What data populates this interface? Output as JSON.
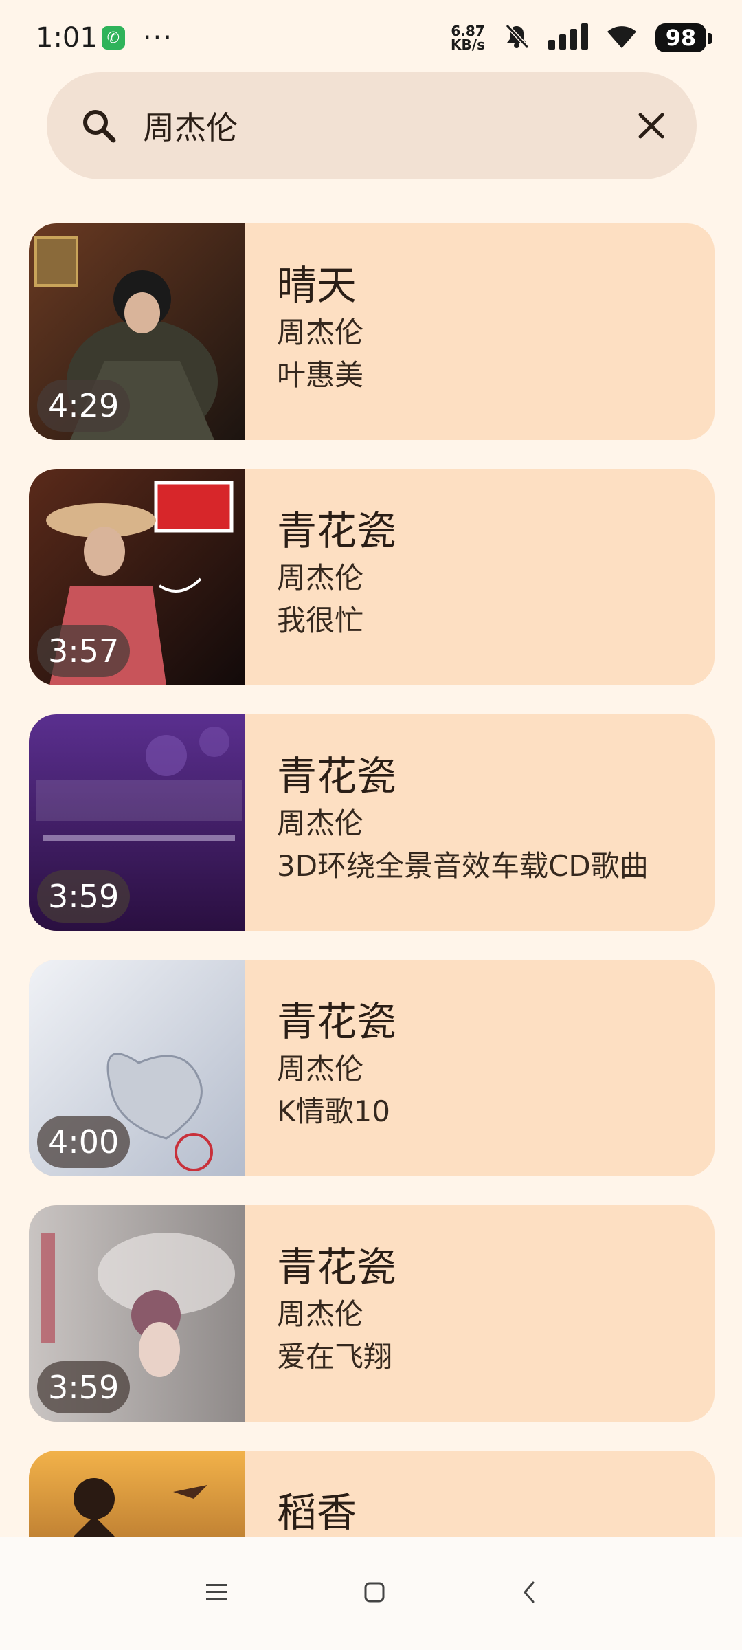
{
  "status_bar": {
    "time": "1:01",
    "dots": "···",
    "speed_value": "6.87",
    "speed_unit": "KB/s",
    "battery": "98"
  },
  "search": {
    "query": "周杰伦"
  },
  "results": [
    {
      "title": "晴天",
      "artist": "周杰伦",
      "album": "叶惠美",
      "duration": "4:29"
    },
    {
      "title": "青花瓷",
      "artist": "周杰伦",
      "album": "我很忙",
      "duration": "3:57"
    },
    {
      "title": "青花瓷",
      "artist": "周杰伦",
      "album": "3D环绕全景音效车载CD歌曲",
      "duration": "3:59"
    },
    {
      "title": "青花瓷",
      "artist": "周杰伦",
      "album": "K情歌10",
      "duration": "4:00"
    },
    {
      "title": "青花瓷",
      "artist": "周杰伦",
      "album": "爱在飞翔",
      "duration": "3:59"
    },
    {
      "title": "稻香",
      "artist": "",
      "album": "",
      "duration": ""
    }
  ],
  "colors": {
    "background": "#fff5ea",
    "search_bg": "#f2e1d3",
    "card_bg": "#fddfc2",
    "nav_bg": "#fdfaf7"
  },
  "icons": {
    "search": "search-icon",
    "clear": "close-icon",
    "nav_menu": "menu-icon",
    "nav_home": "home-icon",
    "nav_back": "back-icon"
  }
}
